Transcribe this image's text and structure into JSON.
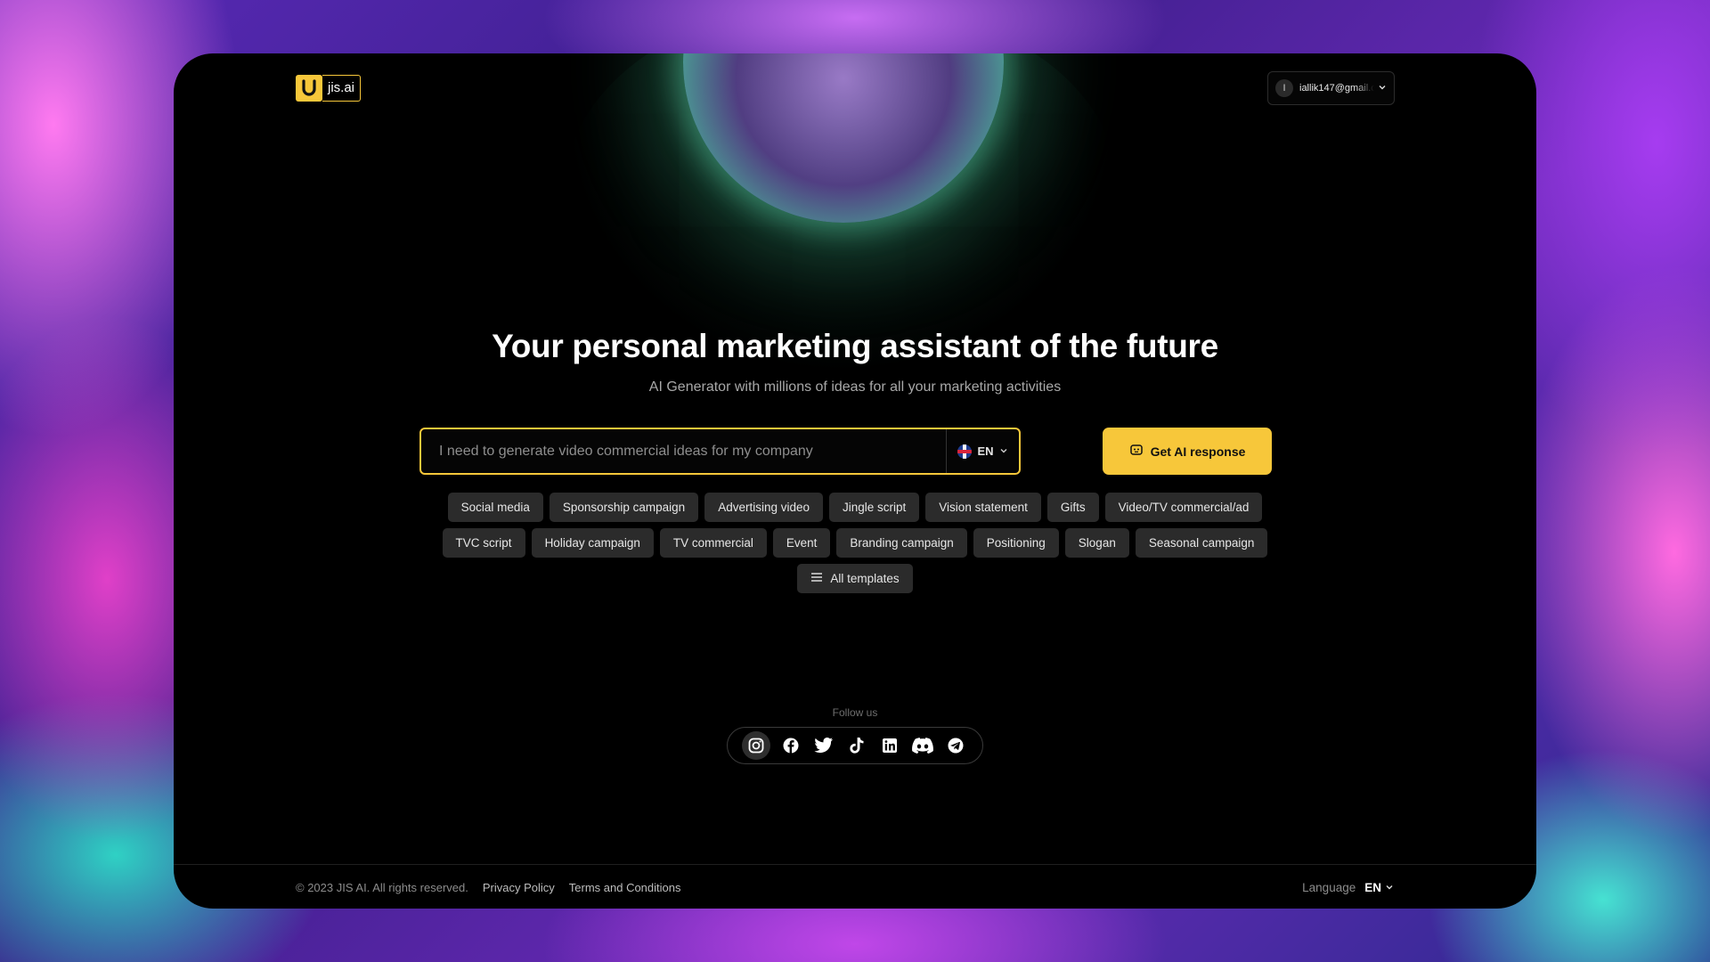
{
  "brand": {
    "name": "jis.ai",
    "accent": "#f7c73a"
  },
  "user": {
    "avatar_initial": "I",
    "email": "iallik147@gmail.com"
  },
  "hero": {
    "title": "Your personal marketing assistant of the future",
    "subtitle": "AI Generator with millions of ideas for all your marketing activities"
  },
  "search": {
    "placeholder": "I need to generate video commercial ideas for my company",
    "value": "",
    "language": "EN",
    "submit_label": "Get AI response"
  },
  "chips": {
    "row1": [
      "Social media",
      "Sponsorship campaign",
      "Advertising video",
      "Jingle script",
      "Vision statement",
      "Gifts",
      "Video/TV commercial/ad"
    ],
    "row2": [
      "TVC script",
      "Holiday campaign",
      "TV commercial",
      "Event",
      "Branding campaign",
      "Positioning",
      "Slogan",
      "Seasonal campaign"
    ],
    "all_templates": "All templates"
  },
  "follow": {
    "label": "Follow us",
    "icons": [
      "instagram-icon",
      "facebook-icon",
      "twitter-icon",
      "tiktok-icon",
      "linkedin-icon",
      "discord-icon",
      "telegram-icon"
    ]
  },
  "footer": {
    "copyright": "© 2023 JIS AI. All rights reserved.",
    "privacy": "Privacy Policy",
    "terms": "Terms and Conditions",
    "language_label": "Language",
    "language_value": "EN"
  }
}
